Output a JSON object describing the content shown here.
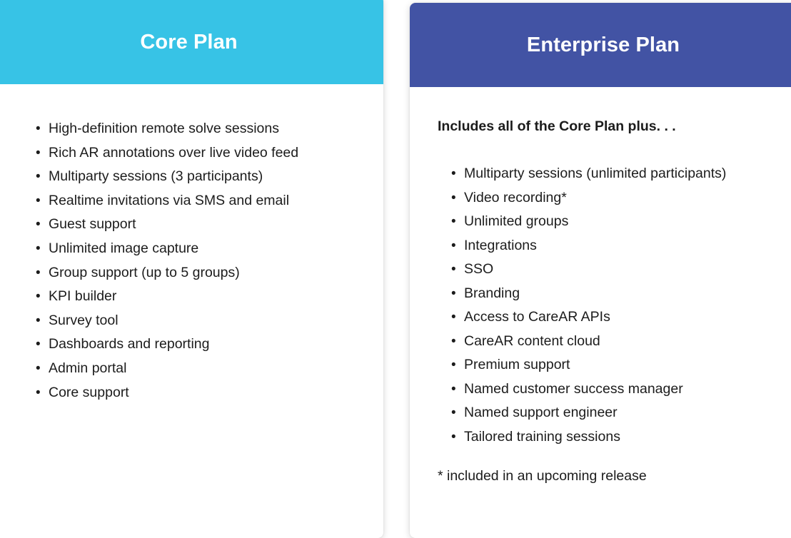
{
  "colors": {
    "core_header_bg": "#37c3e6",
    "enterprise_header_bg": "#4253a4",
    "card_bg": "#ffffff",
    "text": "#1c1c1c",
    "header_text": "#ffffff",
    "page_bg": "#ffffff"
  },
  "plans": [
    {
      "id": "core",
      "title": "Core Plan",
      "intro": "",
      "features": [
        "High-definition remote solve sessions",
        "Rich AR annotations over live video feed",
        "Multiparty sessions (3 participants)",
        "Realtime invitations via SMS and email",
        "Guest support",
        "Unlimited image capture",
        "Group support (up to 5 groups)",
        "KPI builder",
        "Survey tool",
        "Dashboards and reporting",
        "Admin portal",
        "Core support"
      ],
      "footnote": ""
    },
    {
      "id": "enterprise",
      "title": "Enterprise Plan",
      "intro": "Includes all of the Core Plan plus. . .",
      "features": [
        "Multiparty sessions (unlimited participants)",
        "Video recording*",
        "Unlimited groups",
        "Integrations",
        "SSO",
        "Branding",
        "Access to CareAR APIs",
        "CareAR content cloud",
        "Premium support",
        "Named customer success manager",
        "Named support engineer",
        "Tailored training sessions"
      ],
      "footnote": "* included in an upcoming release"
    }
  ],
  "bullet_glyph": "•"
}
